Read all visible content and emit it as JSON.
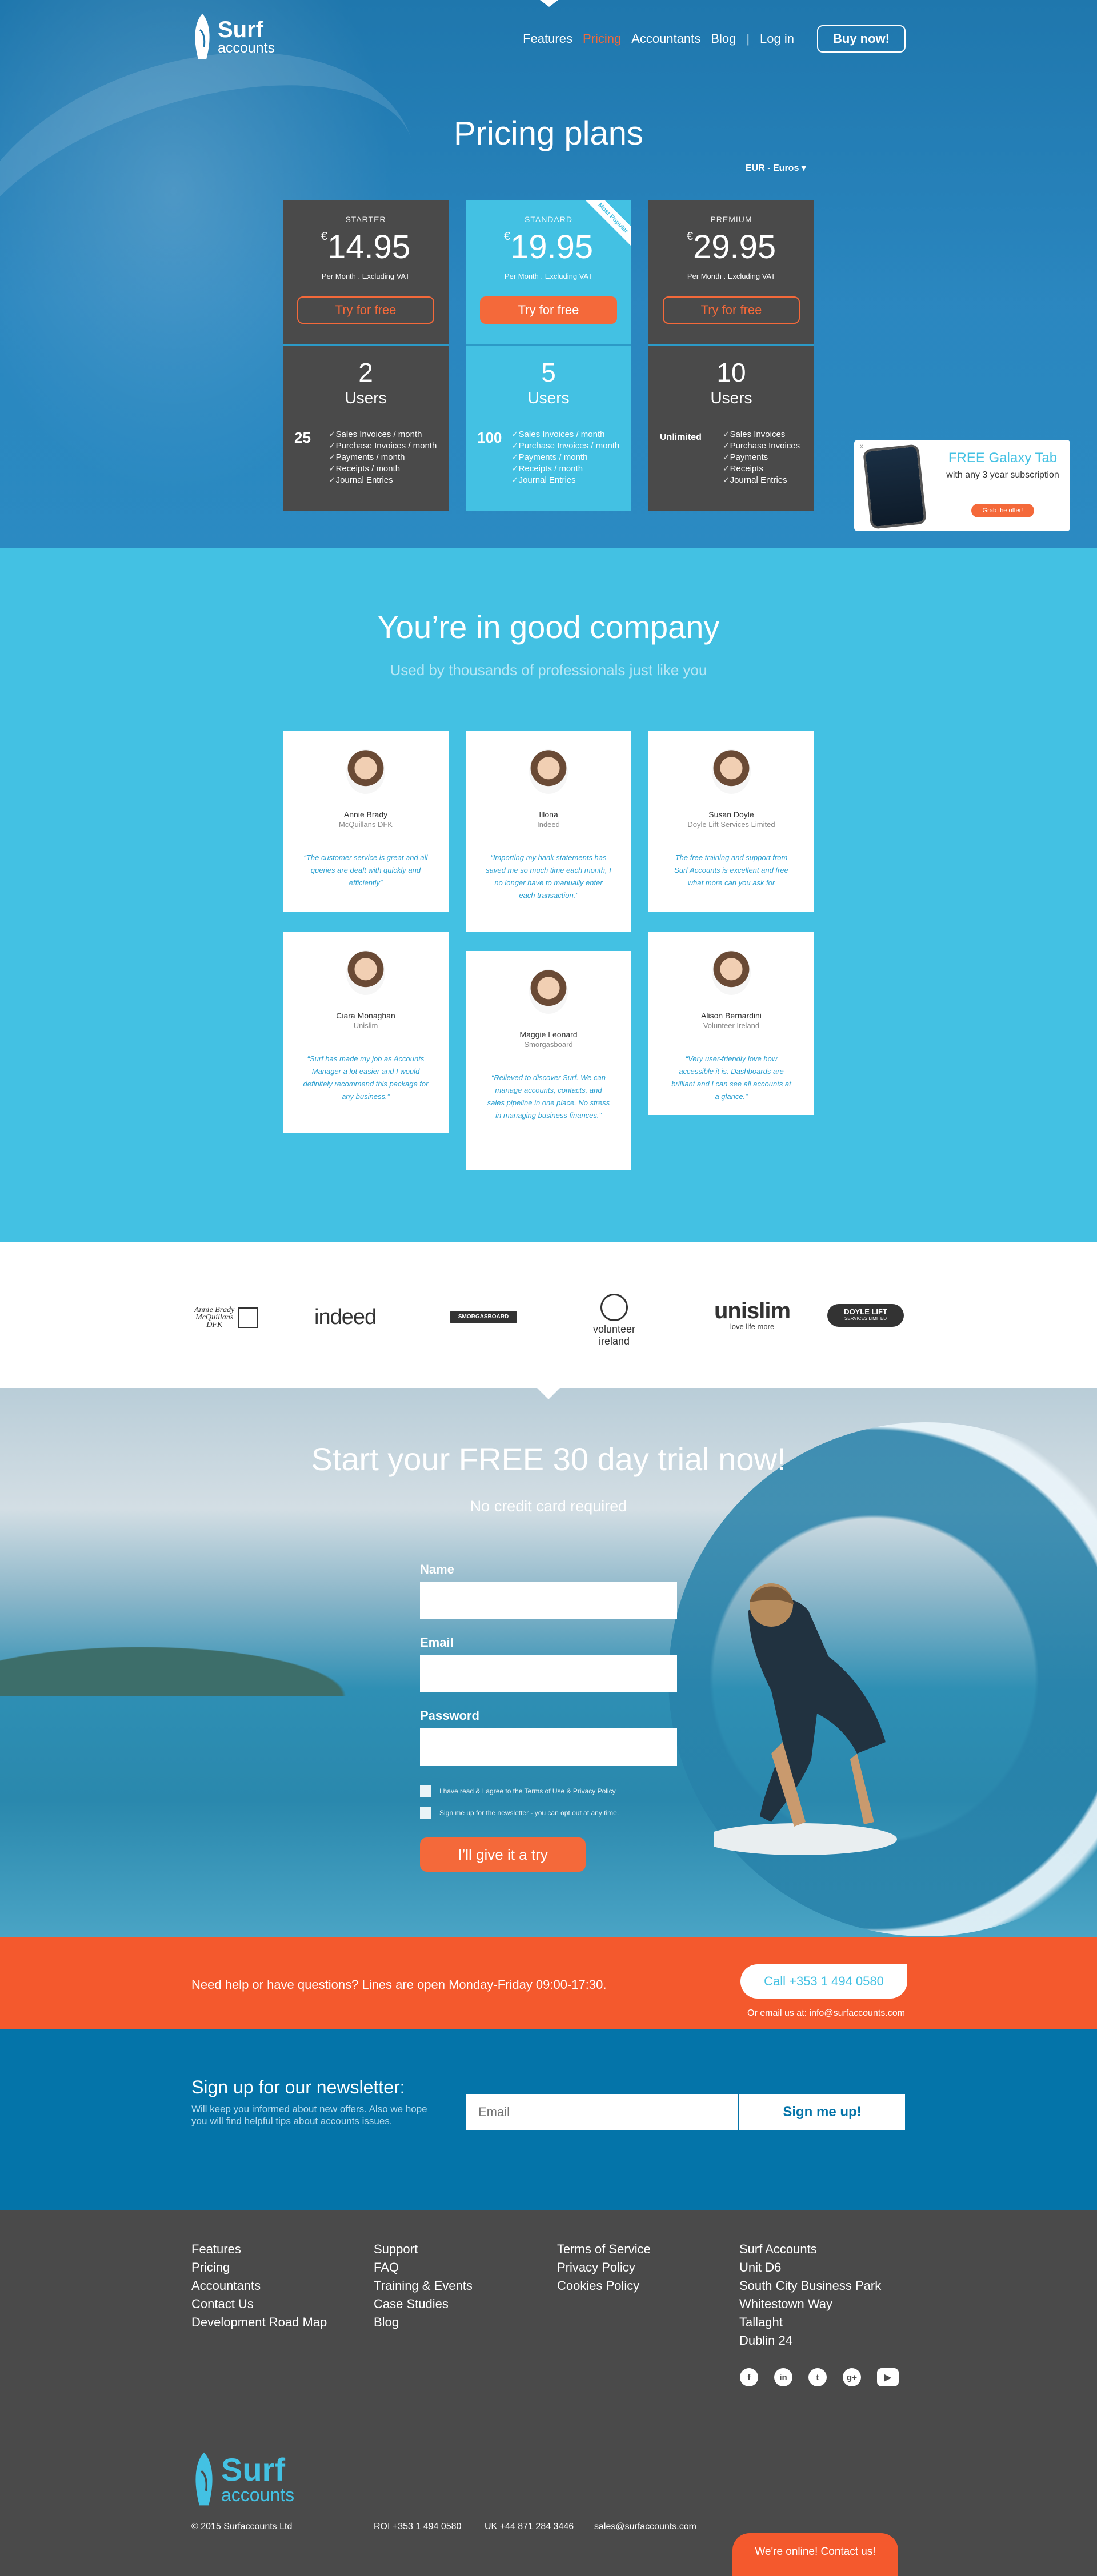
{
  "brand": {
    "name": "Surf",
    "sub": "accounts"
  },
  "nav": {
    "items": [
      "Features",
      "Pricing",
      "Accountants",
      "Blog",
      "Log in"
    ],
    "sep": "|",
    "buy": "Buy now!"
  },
  "hero": {
    "title": "Pricing plans",
    "currency": "EUR - Euros"
  },
  "plans": [
    {
      "tier": "STARTER",
      "symbol": "€",
      "price": "14.95",
      "per": "Per Month . Excluding VAT",
      "try": "Try for free",
      "users_num": "2",
      "users_label": "Users",
      "count": "25",
      "features": [
        "Sales Invoices / month",
        "Purchase Invoices / month",
        "Payments / month",
        "Receipts / month",
        "Journal Entries"
      ]
    },
    {
      "tier": "STANDARD",
      "symbol": "€",
      "price": "19.95",
      "per": "Per Month . Excluding VAT",
      "try": "Try for free",
      "users_num": "5",
      "users_label": "Users",
      "count": "100",
      "ribbon": "Most Popular",
      "features": [
        "Sales Invoices / month",
        "Purchase Invoices / month",
        "Payments / month",
        "Receipts / month",
        "Journal Entries"
      ]
    },
    {
      "tier": "PREMIUM",
      "symbol": "€",
      "price": "29.95",
      "per": "Per Month . Excluding VAT",
      "try": "Try for free",
      "users_num": "10",
      "users_label": "Users",
      "count": "Unlimited",
      "features": [
        "Sales Invoices",
        "Purchase Invoices",
        "Payments",
        "Receipts",
        "Journal Entries"
      ]
    }
  ],
  "promo": {
    "close": "x",
    "title": "FREE Galaxy Tab",
    "text": "with any 3 year subscription",
    "button": "Grab the offer!"
  },
  "company": {
    "title": "You’re in good company",
    "subtitle": "Used by thousands of professionals just like you",
    "testimonials": [
      {
        "name": "Annie Brady",
        "company": "McQuillans DFK",
        "quote": "“The customer service is great and all queries are dealt with quickly and efficiently”"
      },
      {
        "name": "Illona",
        "company": "Indeed",
        "quote": "“Importing my bank statements has saved me so much time each month, I no longer have to manually enter each transaction.”"
      },
      {
        "name": "Susan Doyle",
        "company": "Doyle Lift Services Limited",
        "quote": "The free training and support from Surf Accounts is excellent and free what more can you ask for"
      },
      {
        "name": "Ciara Monaghan",
        "company": "Unislim",
        "quote": "“Surf has made my job as Accounts Manager a lot easier and I would definitely recommend this package for any business.”"
      },
      {
        "name": "Maggie Leonard",
        "company": "Smorgasboard",
        "quote": "“Relieved to discover Surf. We can manage accounts, contacts, and sales pipeline in one place. No stress in managing business finances.”"
      },
      {
        "name": "Alison Bernardini",
        "company": "Volunteer Ireland",
        "quote": "“Very user-friendly love how accessible it is. Dashboards are brilliant and I can see all accounts at a glance.”"
      }
    ]
  },
  "logos": {
    "annie_l1": "Annie Brady",
    "annie_l2": "McQuillans",
    "annie_l3": "DFK",
    "indeed": "indeed",
    "smorg": "SMORGASBOARD",
    "volunteer": "volunteer ireland",
    "unislim": "unislim",
    "unislim_tag": "love life more",
    "doyle": "DOYLE LIFT",
    "doyle_sub": "SERVICES LIMITED"
  },
  "trial": {
    "title": "Start your FREE 30 day trial now!",
    "subtitle": "No credit card required",
    "name_label": "Name",
    "email_label": "Email",
    "password_label": "Password",
    "terms": "I have read & I agree to the Terms of Use & Privacy Policy",
    "newsletter": "Sign me up for the newsletter - you can opt out at any time.",
    "submit": "I’ll give it a try"
  },
  "contact": {
    "message": "Need help or have questions? Lines are open Monday-Friday 09:00-17:30.",
    "call": "Call +353 1 494 0580",
    "email": "Or email us at: info@surfaccounts.com"
  },
  "newsletter": {
    "title": "Sign up for our newsletter:",
    "text": "Will keep you informed about new offers. Also we hope you will find helpful tips about accounts issues.",
    "placeholder": "Email",
    "button": "Sign me up!"
  },
  "footer": {
    "col1": [
      "Features",
      "Pricing",
      "Accountants",
      "Contact Us",
      "Development Road Map"
    ],
    "col2": [
      "Support",
      "FAQ",
      "Training & Events",
      "Case Studies",
      "Blog"
    ],
    "col3": [
      "Terms of Service",
      "Privacy Policy",
      "Cookies Policy"
    ],
    "col4": [
      "Surf Accounts",
      "Unit D6",
      "South City Business Park",
      "Whitestown Way",
      "Tallaght",
      "Dublin 24"
    ],
    "social_icons": [
      "facebook-icon",
      "linkedin-icon",
      "twitter-icon",
      "google-plus-icon",
      "youtube-icon"
    ],
    "copyright": "© 2015  Surfaccounts Ltd",
    "roi": "ROI +353 1 494 0580",
    "uk": "UK +44 871 284 3446",
    "email": "sales@surfaccounts.com",
    "online": "We're online! Contact us!"
  },
  "colors": {
    "accent": "#f4693a",
    "brand_blue": "#43c1e3",
    "dark": "#4a4a4a",
    "navy": "#0474a9"
  }
}
